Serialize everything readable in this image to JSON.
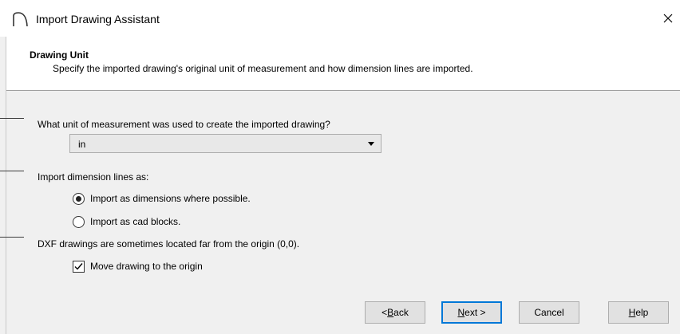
{
  "window": {
    "title": "Import Drawing Assistant"
  },
  "header": {
    "title": "Drawing Unit",
    "subtitle": "Specify the imported drawing's original unit of measurement and how dimension lines are imported."
  },
  "unit_section": {
    "question": "What unit of measurement was used to create the imported drawing?",
    "selected_unit": "in"
  },
  "dimension_section": {
    "question": "Import dimension lines as:",
    "options": [
      {
        "label": "Import as dimensions where possible.",
        "selected": true
      },
      {
        "label": "Import as cad blocks.",
        "selected": false
      }
    ]
  },
  "origin_section": {
    "question": "DXF drawings are sometimes located far from the origin (0,0).",
    "checkbox_label": "Move drawing to the origin",
    "checked": true
  },
  "buttons": {
    "back": {
      "pre": "< ",
      "mnemonic": "B",
      "post": "ack"
    },
    "next": {
      "mnemonic": "N",
      "post": "ext >"
    },
    "cancel": "Cancel",
    "help": {
      "mnemonic": "H",
      "post": "elp"
    }
  },
  "colors": {
    "default_button_border": "#0078d7",
    "dialog_bg": "#f0f0f0",
    "header_bg": "#ffffff"
  }
}
